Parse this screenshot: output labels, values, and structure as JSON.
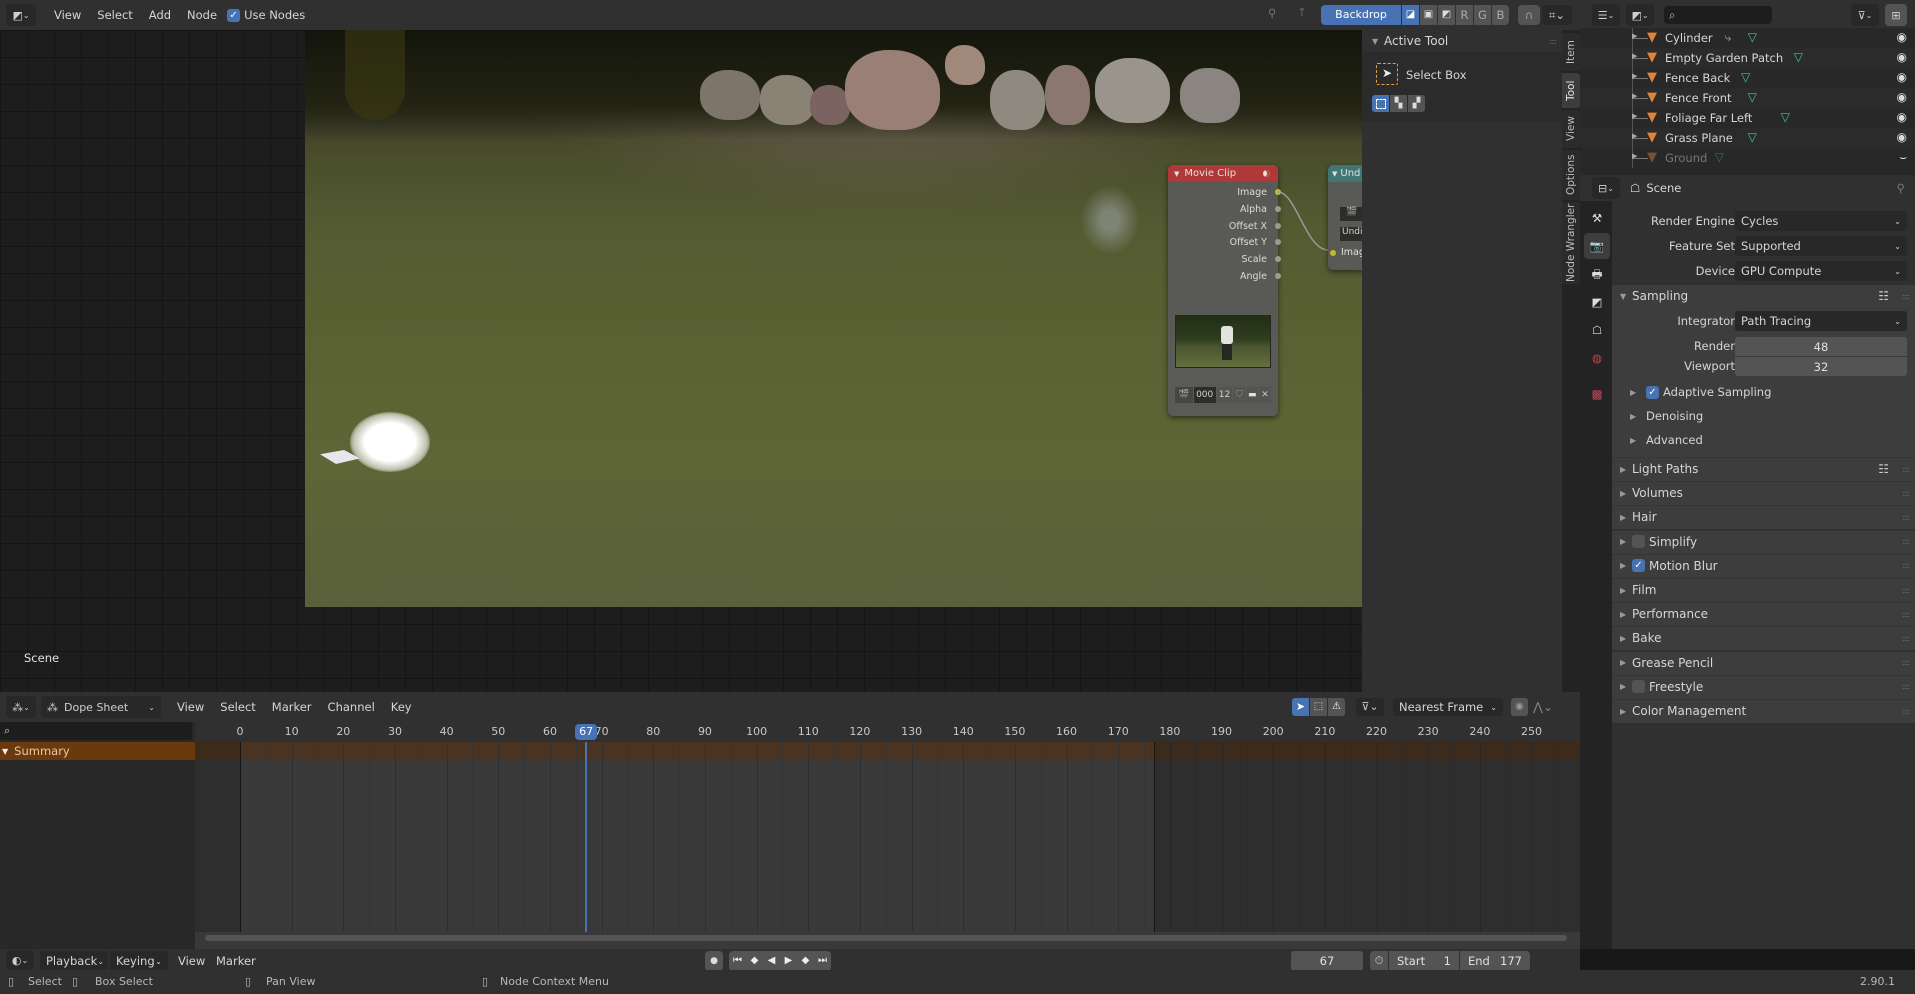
{
  "node_editor": {
    "header": {
      "editor_type_icon": "node-editor-icon",
      "menus": [
        "View",
        "Select",
        "Add",
        "Node"
      ],
      "use_nodes_label": "Use Nodes",
      "use_nodes_checked": true,
      "backdrop_label": "Backdrop",
      "channel_buttons": [
        "R",
        "G",
        "B"
      ]
    },
    "scene_label": "Scene",
    "nodes": {
      "movie_clip": {
        "title": "Movie Clip",
        "header_color": "#b8373a",
        "outputs": [
          "Image",
          "Alpha",
          "Offset X",
          "Offset Y",
          "Scale",
          "Angle"
        ],
        "clip_frame": "000",
        "clip_users": "12"
      },
      "undistortion": {
        "title": "Und",
        "header_color": "#3f7a7a",
        "field": "Undi",
        "input": "Image"
      }
    },
    "sidebar": {
      "panel_title": "Active Tool",
      "tool_name": "Select Box",
      "tabs": [
        "Item",
        "Tool",
        "View",
        "Options",
        "Node Wrangler"
      ],
      "active_tab": "Tool"
    }
  },
  "dope_sheet": {
    "mode_label": "Dope Sheet",
    "menus": [
      "View",
      "Select",
      "Marker",
      "Channel",
      "Key"
    ],
    "snap_label": "Nearest Frame",
    "search_placeholder": "",
    "summary_label": "Summary",
    "current_frame": "67",
    "ruler_ticks": [
      "0",
      "10",
      "20",
      "30",
      "40",
      "50",
      "60",
      "70",
      "80",
      "90",
      "100",
      "110",
      "120",
      "130",
      "140",
      "150",
      "160",
      "170",
      "180",
      "190",
      "200",
      "210",
      "220",
      "230",
      "240",
      "250"
    ],
    "scene_end_frame": 177
  },
  "timeline": {
    "menus": [
      "Playback",
      "Keying",
      "View",
      "Marker"
    ],
    "current_frame": "67",
    "start_label": "Start",
    "start_value": "1",
    "end_label": "End",
    "end_value": "177"
  },
  "outliner": {
    "search_placeholder": "",
    "items": [
      {
        "name": "Cylinder",
        "visible": true,
        "dimmed": false,
        "has_modifier": true
      },
      {
        "name": "Empty Garden Patch",
        "visible": true,
        "dimmed": false,
        "has_modifier": false
      },
      {
        "name": "Fence Back",
        "visible": true,
        "dimmed": false,
        "has_modifier": false
      },
      {
        "name": "Fence Front",
        "visible": true,
        "dimmed": false,
        "has_modifier": false
      },
      {
        "name": "Foliage Far Left",
        "visible": true,
        "dimmed": false,
        "has_modifier": false
      },
      {
        "name": "Grass Plane",
        "visible": true,
        "dimmed": false,
        "has_modifier": false
      },
      {
        "name": "Ground",
        "visible": false,
        "dimmed": true,
        "has_modifier": false
      }
    ]
  },
  "properties": {
    "context_label": "Scene",
    "render_engine_label": "Render Engine",
    "render_engine": "Cycles",
    "feature_set_label": "Feature Set",
    "feature_set": "Supported",
    "device_label": "Device",
    "device": "GPU Compute",
    "sampling": {
      "title": "Sampling",
      "integrator_label": "Integrator",
      "integrator": "Path Tracing",
      "render_label": "Render",
      "render_samples": "48",
      "viewport_label": "Viewport",
      "viewport_samples": "32",
      "subpanels": [
        {
          "label": "Adaptive Sampling",
          "checkbox": true
        },
        {
          "label": "Denoising",
          "checkbox": null
        },
        {
          "label": "Advanced",
          "checkbox": null
        }
      ]
    },
    "panels": [
      {
        "label": "Light Paths",
        "checkbox": null,
        "presets": true
      },
      {
        "label": "Volumes",
        "checkbox": null
      },
      {
        "label": "Hair",
        "checkbox": null
      },
      {
        "label": "Simplify",
        "checkbox": false
      },
      {
        "label": "Motion Blur",
        "checkbox": true
      },
      {
        "label": "Film",
        "checkbox": null
      },
      {
        "label": "Performance",
        "checkbox": null
      },
      {
        "label": "Bake",
        "checkbox": null
      },
      {
        "label": "Grease Pencil",
        "checkbox": null
      },
      {
        "label": "Freestyle",
        "checkbox": false
      },
      {
        "label": "Color Management",
        "checkbox": null
      }
    ]
  },
  "statusbar": {
    "items": [
      {
        "icon": "mouse-left-icon",
        "label": "Select"
      },
      {
        "icon": "mouse-drag-icon",
        "label": "Box Select"
      },
      {
        "icon": "mouse-middle-icon",
        "label": "Pan View"
      },
      {
        "icon": "mouse-right-icon",
        "label": "Node Context Menu"
      }
    ],
    "version": "2.90.1"
  },
  "colors": {
    "accent": "#4772b3",
    "summary_row": "#6a3a0c",
    "playhead": "#4772b3",
    "mesh_icon": "#3dc49a",
    "object_icon": "#e0843a"
  }
}
